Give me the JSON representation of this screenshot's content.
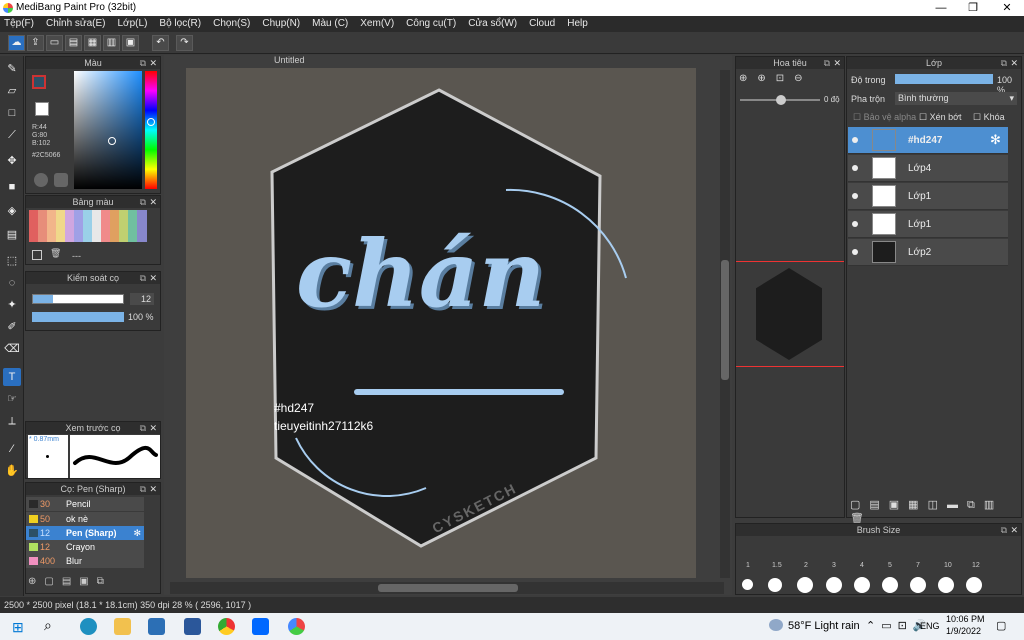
{
  "app": {
    "title": "MediBang Paint Pro (32bit)"
  },
  "menu": [
    "Tệp(F)",
    "Chỉnh sửa(E)",
    "Lớp(L)",
    "Bộ lọc(R)",
    "Chọn(S)",
    "Chụp(N)",
    "Màu (C)",
    "Xem(V)",
    "Công cụ(T)",
    "Cửa sổ(W)",
    "Cloud",
    "Help"
  ],
  "canvas": {
    "tab": "Untitled"
  },
  "panels": {
    "color": {
      "title": "Màu",
      "r": "R:44",
      "g": "G:80",
      "b": "B:102",
      "hex": "#2C5066"
    },
    "palette": {
      "title": "Bảng màu",
      "extra": "---"
    },
    "brush_control": {
      "title": "Kiểm soát cọ",
      "size": "12",
      "opacity": "100 %"
    },
    "brush_preview": {
      "title": "Xem trước cọ",
      "size": "* 0.87mm"
    },
    "brush_list": {
      "title": "Cọ: Pen (Sharp)",
      "items": [
        {
          "num": "30",
          "name": "Pencil",
          "color": "#2a2a2a"
        },
        {
          "num": "50",
          "name": "ok nè",
          "color": "#f0d020"
        },
        {
          "num": "12",
          "name": "Pen (Sharp)",
          "color": "#2c5066"
        },
        {
          "num": "12",
          "name": "Crayon",
          "color": "#b0e060"
        },
        {
          "num": "400",
          "name": "Blur",
          "color": "#f090c0"
        }
      ]
    },
    "navigator": {
      "title": "Hoa tiêu",
      "angle": "0 độ"
    },
    "layers": {
      "title": "Lớp",
      "opacity_label": "Độ trong",
      "opacity_value": "100 %",
      "blend_label": "Pha trộn",
      "blend_value": "Bình thường",
      "protect_alpha": "Bảo vệ alpha",
      "clip": "Xén bớt",
      "lock": "Khóa",
      "items": [
        {
          "name": "#hd247"
        },
        {
          "name": "Lớp4"
        },
        {
          "name": "Lớp1"
        },
        {
          "name": "Lớp1"
        },
        {
          "name": "Lớp2"
        }
      ]
    },
    "brush_size": {
      "title": "Brush Size",
      "labels": [
        "1",
        "1.5",
        "2",
        "3",
        "4",
        "5",
        "7",
        "10",
        "12"
      ]
    }
  },
  "artwork": {
    "main_text": "chán",
    "line1": "#hd247",
    "line2": "tieuyeitinh27112k6",
    "watermark": "CYSKETCH"
  },
  "status": {
    "text": "2500 * 2500 pixel   (18.1 * 18.1cm)   350 dpi   28 %   ( 2596, 1017 )"
  },
  "taskbar": {
    "weather": "58°F  Light rain",
    "lang": "ENG",
    "time": "10:06 PM",
    "date": "1/9/2022"
  },
  "colors": {
    "selected": "#4d8fd1",
    "accent": "#a8cdf0",
    "fg": "#2c5066"
  }
}
